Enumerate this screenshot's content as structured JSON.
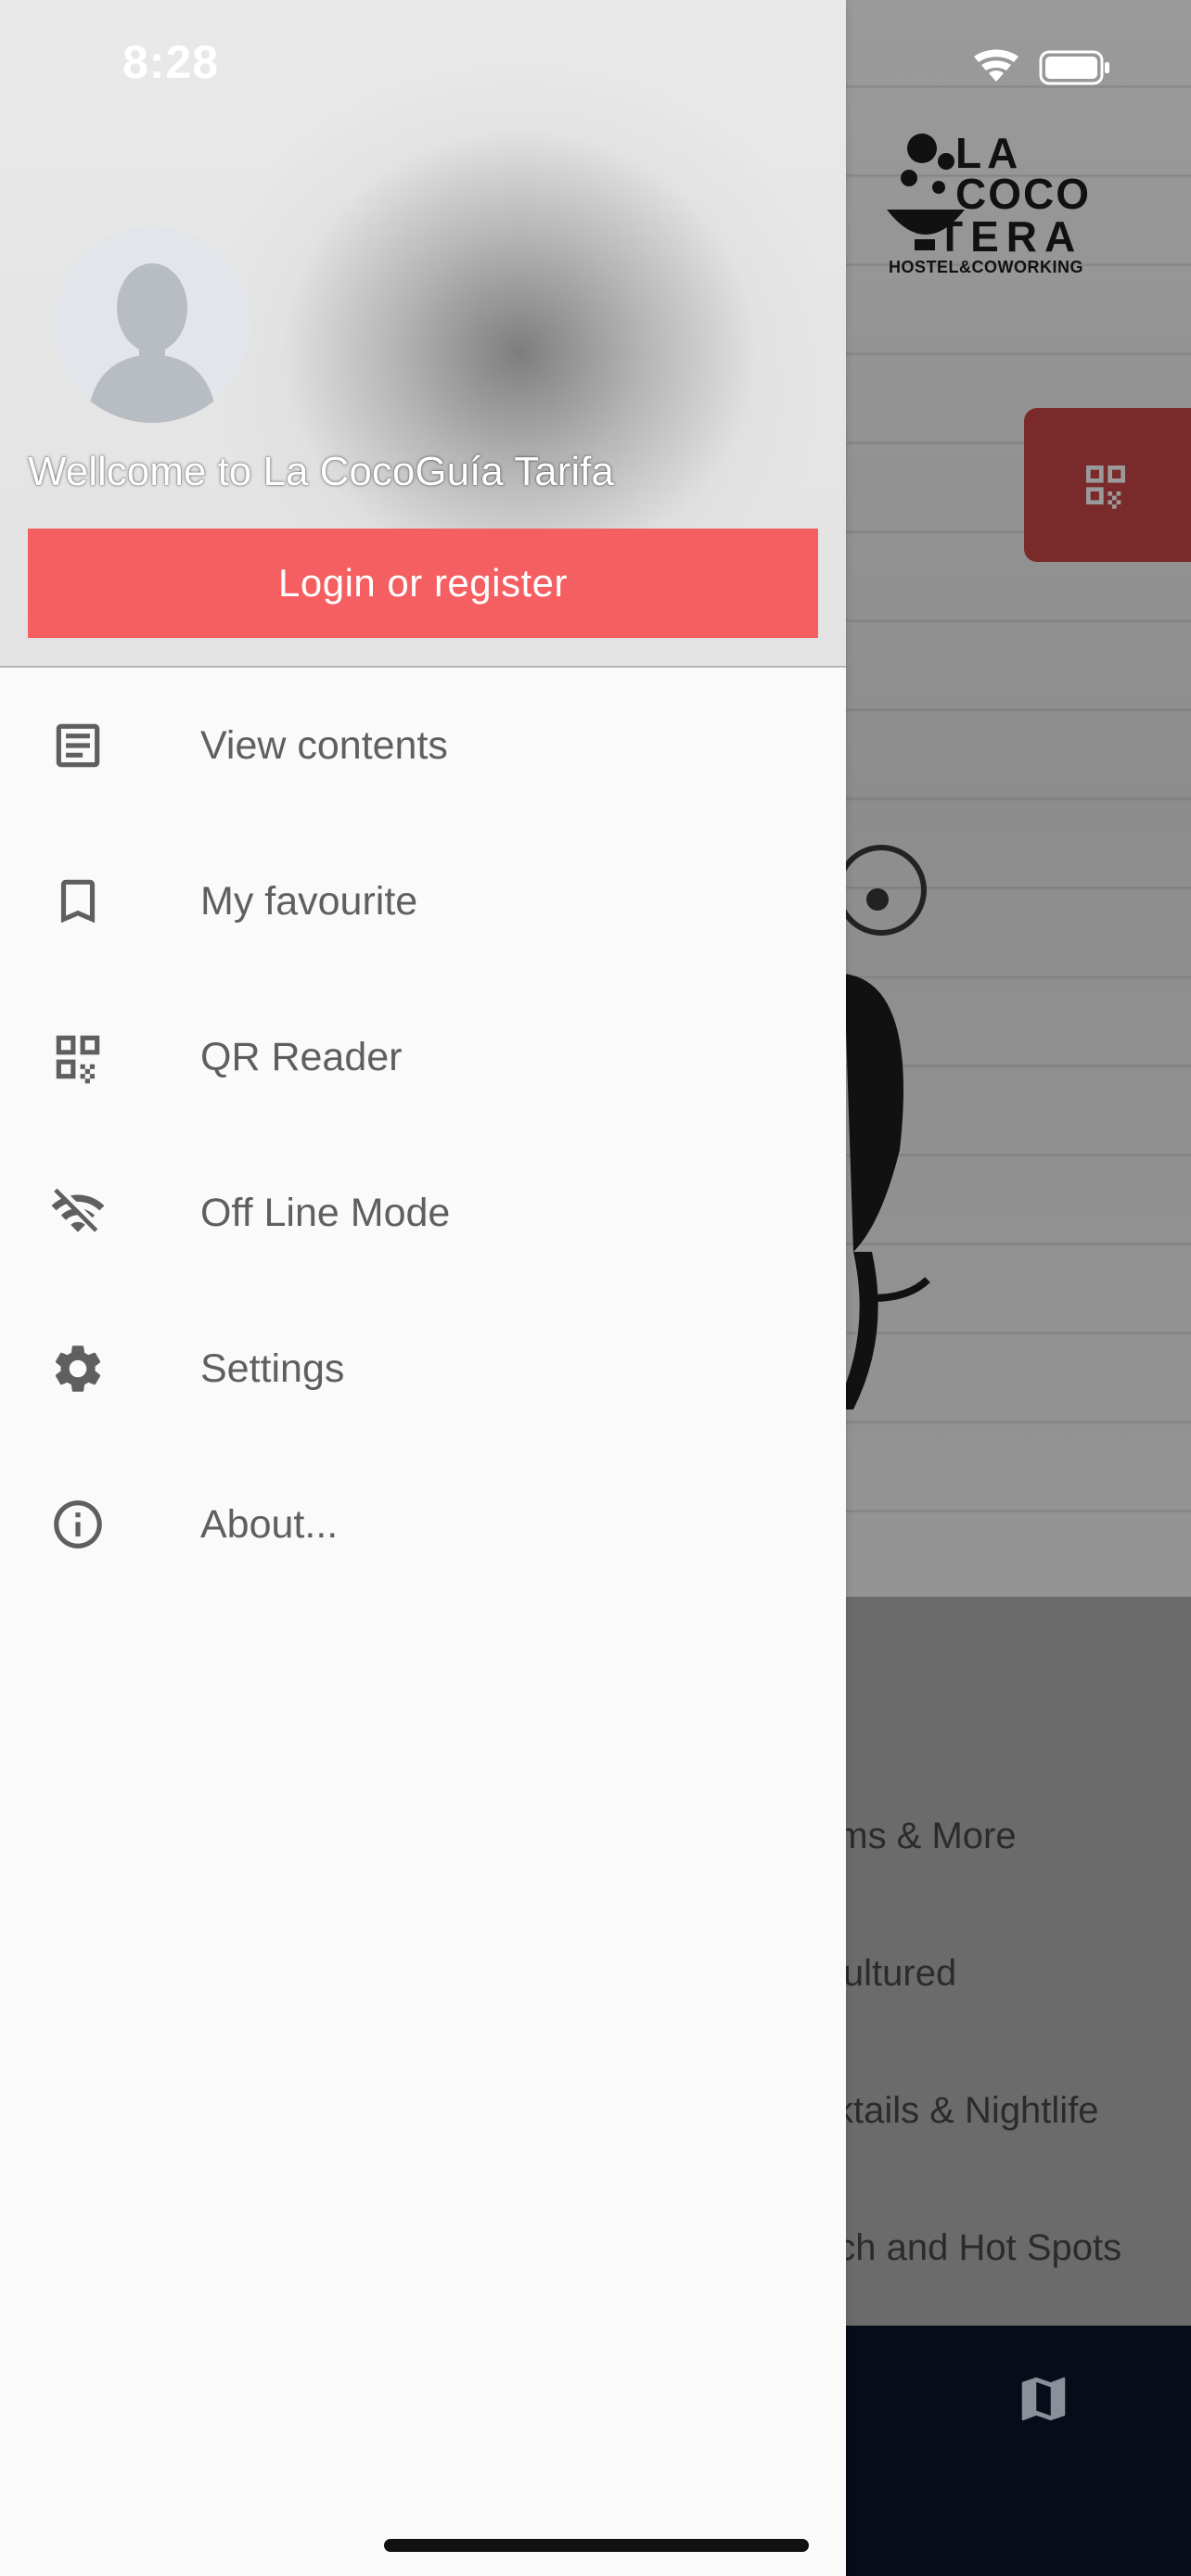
{
  "status_bar": {
    "time": "8:28"
  },
  "drawer": {
    "welcome_text": "Wellcome to La CocoGuía Tarifa",
    "login_button": "Login or register",
    "menu": [
      {
        "label": "View contents",
        "icon": "article-icon"
      },
      {
        "label": "My favourite",
        "icon": "bookmark-icon"
      },
      {
        "label": "QR Reader",
        "icon": "qr-code-icon"
      },
      {
        "label": "Off Line Mode",
        "icon": "wifi-off-icon"
      },
      {
        "label": "Settings",
        "icon": "gear-icon"
      },
      {
        "label": "About...",
        "icon": "info-icon"
      }
    ]
  },
  "background_app": {
    "logo": {
      "line1": "LA",
      "line2": "COCO",
      "line3": "TERA",
      "line4": "HOSTEL&COWORKING"
    },
    "list_items": [
      "oms & More",
      "Cultured",
      "cktails & Nightlife",
      "ach and Hot Spots"
    ]
  },
  "colors": {
    "accent": "#f55f62",
    "menu_text": "#5f5f5f",
    "bottom_bar": "#060c18"
  }
}
